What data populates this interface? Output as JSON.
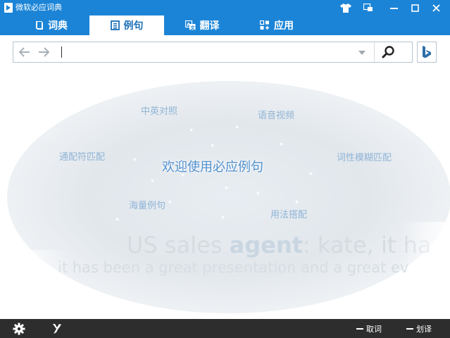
{
  "window": {
    "title": "微软必应词典"
  },
  "tabs": [
    {
      "label": "词典",
      "icon": "book-icon",
      "active": false
    },
    {
      "label": "例句",
      "icon": "document-icon",
      "active": true
    },
    {
      "label": "翻译",
      "icon": "translate-icon",
      "active": false
    },
    {
      "label": "应用",
      "icon": "apps-icon",
      "active": false
    }
  ],
  "search": {
    "value": "",
    "placeholder": ""
  },
  "welcome": {
    "title": "欢迎使用必应例句",
    "features": [
      "中英对照",
      "语音视频",
      "通配符匹配",
      "词性模糊匹配",
      "海量例句",
      "用法搭配"
    ]
  },
  "sample": {
    "line1_before": "US sales ",
    "line1_keyword": "agent",
    "line1_after": ": kate, it ha",
    "line2": "it has been a great presentation and a great ev"
  },
  "bottom": {
    "take_word": "取词",
    "select_translate": "划译"
  },
  "colors": {
    "accent": "#1b84d7",
    "bottom_bar": "#2d2d2d"
  }
}
